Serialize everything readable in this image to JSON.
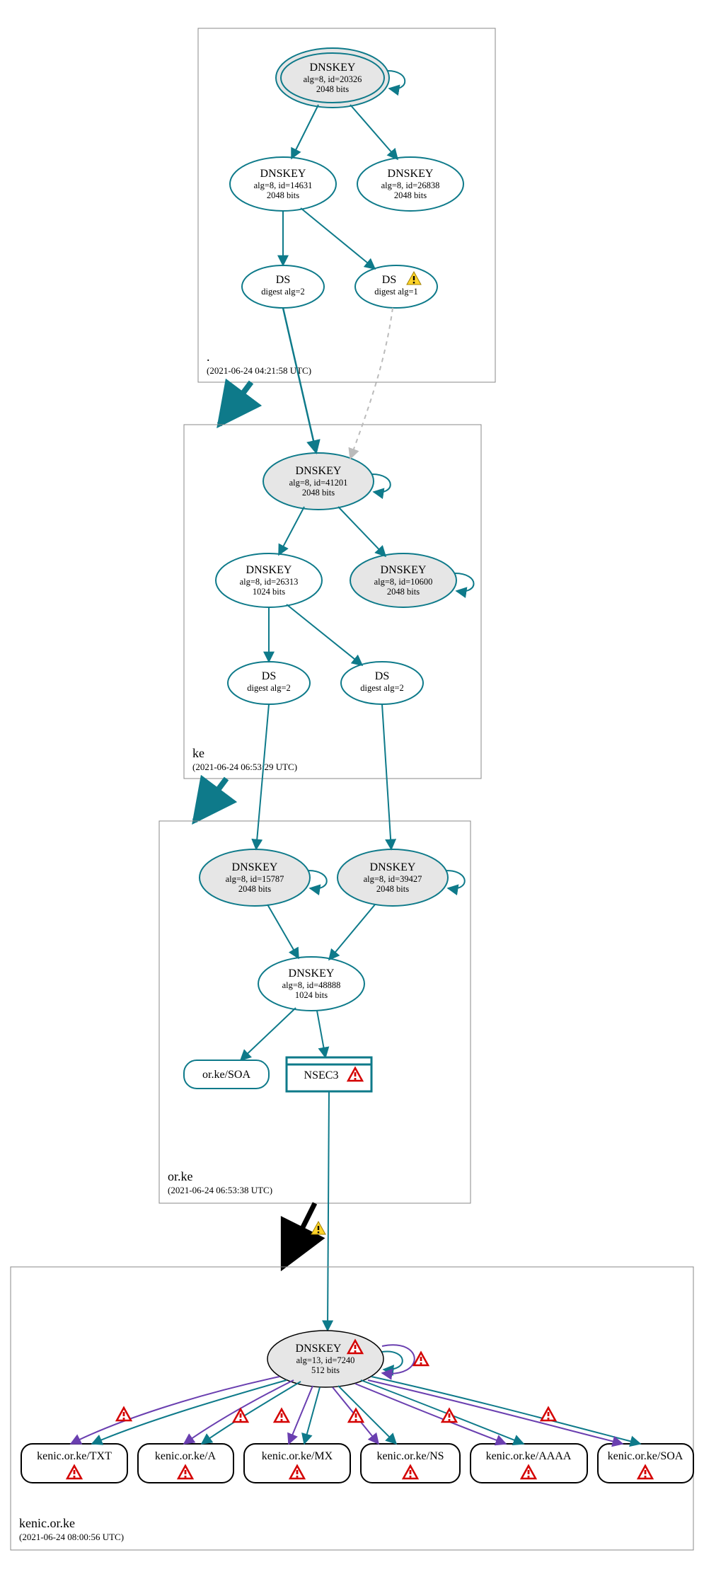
{
  "zones": {
    "root": {
      "name": ".",
      "timestamp": "(2021-06-24 04:21:58 UTC)"
    },
    "ke": {
      "name": "ke",
      "timestamp": "(2021-06-24 06:53:29 UTC)"
    },
    "orke": {
      "name": "or.ke",
      "timestamp": "(2021-06-24 06:53:38 UTC)"
    },
    "kenic": {
      "name": "kenic.or.ke",
      "timestamp": "(2021-06-24 08:00:56 UTC)"
    }
  },
  "nodes": {
    "root_ksk": {
      "t": "DNSKEY",
      "l2": "alg=8, id=20326",
      "l3": "2048 bits"
    },
    "root_k1": {
      "t": "DNSKEY",
      "l2": "alg=8, id=14631",
      "l3": "2048 bits"
    },
    "root_k2": {
      "t": "DNSKEY",
      "l2": "alg=8, id=26838",
      "l3": "2048 bits"
    },
    "root_ds1": {
      "t": "DS",
      "l2": "digest alg=2"
    },
    "root_ds2": {
      "t": "DS",
      "l2": "digest alg=1"
    },
    "ke_ksk": {
      "t": "DNSKEY",
      "l2": "alg=8, id=41201",
      "l3": "2048 bits"
    },
    "ke_k1": {
      "t": "DNSKEY",
      "l2": "alg=8, id=26313",
      "l3": "1024 bits"
    },
    "ke_k2": {
      "t": "DNSKEY",
      "l2": "alg=8, id=10600",
      "l3": "2048 bits"
    },
    "ke_ds1": {
      "t": "DS",
      "l2": "digest alg=2"
    },
    "ke_ds2": {
      "t": "DS",
      "l2": "digest alg=2"
    },
    "orke_k1": {
      "t": "DNSKEY",
      "l2": "alg=8, id=15787",
      "l3": "2048 bits"
    },
    "orke_k2": {
      "t": "DNSKEY",
      "l2": "alg=8, id=39427",
      "l3": "2048 bits"
    },
    "orke_k3": {
      "t": "DNSKEY",
      "l2": "alg=8, id=48888",
      "l3": "1024 bits"
    },
    "orke_soa": {
      "t": "or.ke/SOA"
    },
    "orke_nsec3": {
      "t": "NSEC3"
    },
    "kenic_k": {
      "t": "DNSKEY",
      "l2": "alg=13, id=7240",
      "l3": "512 bits"
    },
    "kenic_txt": {
      "t": "kenic.or.ke/TXT"
    },
    "kenic_a": {
      "t": "kenic.or.ke/A"
    },
    "kenic_mx": {
      "t": "kenic.or.ke/MX"
    },
    "kenic_ns": {
      "t": "kenic.or.ke/NS"
    },
    "kenic_aaaa": {
      "t": "kenic.or.ke/AAAA"
    },
    "kenic_soa": {
      "t": "kenic.or.ke/SOA"
    }
  }
}
